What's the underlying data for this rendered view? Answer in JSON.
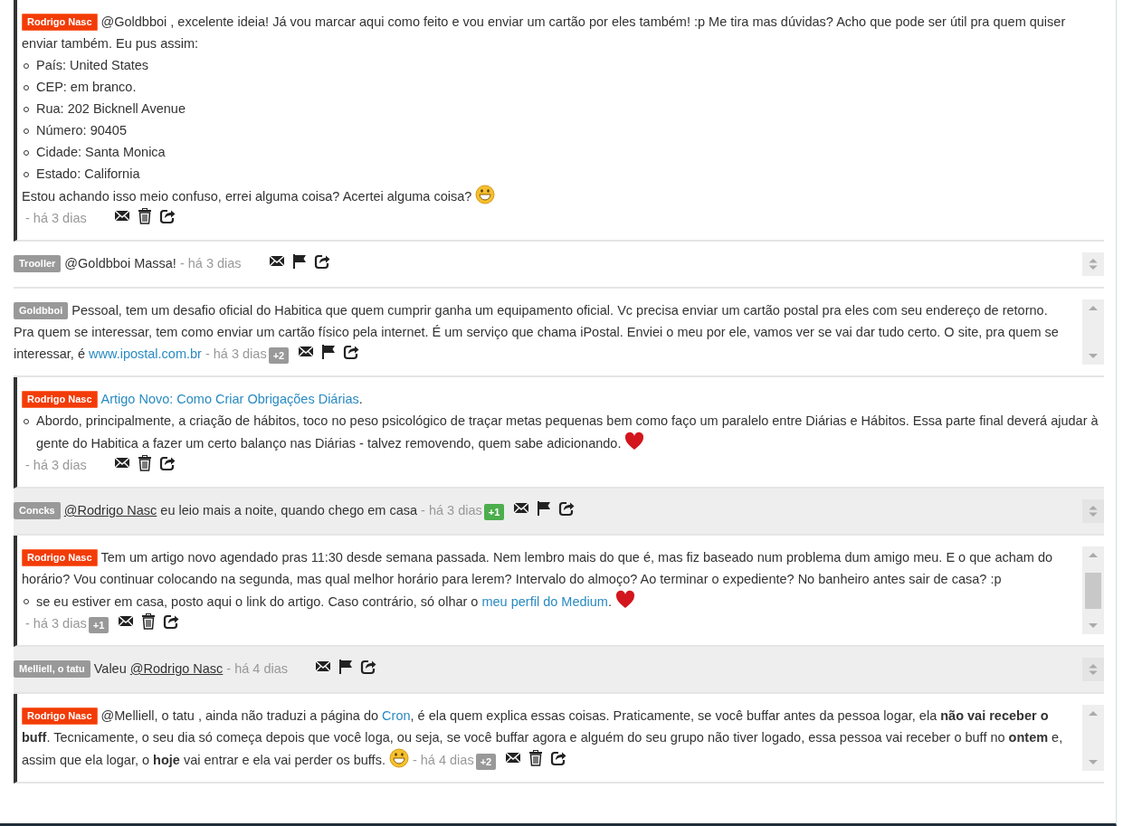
{
  "messages": [
    {
      "author": {
        "name": "Rodrigo Nasc",
        "kind": "leader"
      },
      "own": true,
      "highlighted": false,
      "inline_time": false,
      "paragraphs": [
        {
          "kind": "line",
          "segments": [
            {
              "kind": "text",
              "text": "@Goldbboi , excelente ideia! Já vou marcar aqui como feito e vou enviar um cartão por eles também! :p Me tira mas dúvidas? Acho que pode ser útil pra quem quiser enviar também. Eu pus assim:"
            }
          ]
        },
        {
          "kind": "bullet",
          "segments": [
            {
              "kind": "text",
              "text": "País: United States"
            }
          ]
        },
        {
          "kind": "bullet",
          "segments": [
            {
              "kind": "text",
              "text": "CEP: em branco."
            }
          ]
        },
        {
          "kind": "bullet",
          "segments": [
            {
              "kind": "text",
              "text": "Rua: 202 Bicknell Avenue"
            }
          ]
        },
        {
          "kind": "bullet",
          "segments": [
            {
              "kind": "text",
              "text": "Número: 90405"
            }
          ]
        },
        {
          "kind": "bullet",
          "segments": [
            {
              "kind": "text",
              "text": "Cidade: Santa Monica"
            }
          ]
        },
        {
          "kind": "bullet",
          "segments": [
            {
              "kind": "text",
              "text": "Estado: California"
            }
          ]
        },
        {
          "kind": "line",
          "segments": [
            {
              "kind": "text",
              "text": "Estou achando isso meio confuso, errei alguma coisa? Acertei alguma coisa?"
            },
            {
              "kind": "smiley"
            }
          ]
        }
      ],
      "time": "- há 3 dias",
      "actions": [
        {
          "kind": "mail"
        },
        {
          "kind": "trash"
        },
        {
          "kind": "share"
        }
      ]
    },
    {
      "author": {
        "name": "Trooller",
        "kind": "member"
      },
      "own": false,
      "highlighted": false,
      "side_control": {
        "kind": "compact"
      },
      "inline_time": true,
      "paragraphs": [
        {
          "kind": "line",
          "segments": [
            {
              "kind": "text",
              "text": "@Goldbboi Massa!"
            }
          ]
        }
      ],
      "time": "- há 3 dias",
      "actions": [
        {
          "kind": "mail"
        },
        {
          "kind": "flag"
        },
        {
          "kind": "share"
        }
      ]
    },
    {
      "author": {
        "name": "Goldbboi",
        "kind": "member"
      },
      "own": false,
      "highlighted": false,
      "side_control": {
        "kind": "arrows"
      },
      "inline_time": true,
      "paragraphs": [
        {
          "kind": "line",
          "segments": [
            {
              "kind": "text",
              "text": "Pessoal, tem um desafio oficial do Habitica que quem cumprir ganha um equipamento oficial. Vc precisa enviar um cartão postal pra eles com seu endereço de retorno. Pra quem se interessar, tem como enviar um cartão físico pela internet. É um serviço que chama iPostal. Enviei o meu por ele, vamos ver se vai dar tudo certo. O site, pra quem se interessar, é"
            },
            {
              "kind": "link",
              "text": "www.ipostal.com.br"
            }
          ]
        }
      ],
      "time": "- há 3 dias",
      "votes": {
        "text": "+2",
        "color": "#999999"
      },
      "actions": [
        {
          "kind": "mail"
        },
        {
          "kind": "flag"
        },
        {
          "kind": "share"
        }
      ]
    },
    {
      "author": {
        "name": "Rodrigo Nasc",
        "kind": "leader"
      },
      "own": true,
      "highlighted": false,
      "inline_time": false,
      "paragraphs": [
        {
          "kind": "line",
          "segments": [
            {
              "kind": "link",
              "text": "Artigo Novo: Como Criar Obrigações Diárias"
            },
            {
              "kind": "text",
              "text": "."
            }
          ]
        },
        {
          "kind": "bullet",
          "segments": [
            {
              "kind": "text",
              "text": "Abordo, principalmente, a criação de hábitos, toco no peso psicológico de traçar metas pequenas bem como faço um paralelo entre Diárias e Hábitos. Essa parte final deverá ajudar à gente do Habitica a fazer um certo balanço nas Diárias - talvez removendo, quem sabe adicionando."
            },
            {
              "kind": "heart"
            }
          ]
        }
      ],
      "time": "- há 3 dias",
      "actions": [
        {
          "kind": "mail"
        },
        {
          "kind": "trash"
        },
        {
          "kind": "share"
        }
      ]
    },
    {
      "author": {
        "name": "Concks",
        "kind": "member"
      },
      "own": false,
      "highlighted": true,
      "side_control": {
        "kind": "compact"
      },
      "inline_time": true,
      "paragraphs": [
        {
          "kind": "line",
          "segments": [
            {
              "kind": "mention",
              "text": "@Rodrigo Nasc"
            },
            {
              "kind": "text",
              "text": "eu leio mais a noite, quando chego em casa"
            }
          ]
        }
      ],
      "time": "- há 3 dias",
      "votes": {
        "text": "+1",
        "color": "#4cae4c"
      },
      "actions": [
        {
          "kind": "mail"
        },
        {
          "kind": "flag"
        },
        {
          "kind": "share"
        }
      ]
    },
    {
      "author": {
        "name": "Rodrigo Nasc",
        "kind": "leader"
      },
      "own": true,
      "highlighted": false,
      "side_control": {
        "kind": "scroll"
      },
      "inline_time": false,
      "paragraphs": [
        {
          "kind": "line",
          "segments": [
            {
              "kind": "text",
              "text": "Tem um artigo novo agendado pras 11:30 desde semana passada. Nem lembro mais do que é, mas fiz baseado num problema dum amigo meu. E o que acham do horário? Vou continuar colocando na segunda, mas qual melhor horário para lerem? Intervalo do almoço? Ao terminar o expediente? No banheiro antes sair de casa? :p"
            }
          ]
        },
        {
          "kind": "bullet",
          "segments": [
            {
              "kind": "text",
              "text": "se eu estiver em casa, posto aqui o link do artigo. Caso contrário, só olhar o"
            },
            {
              "kind": "link",
              "text": "meu perfil do Medium"
            },
            {
              "kind": "text",
              "text": "."
            },
            {
              "kind": "heart"
            }
          ]
        }
      ],
      "time": "- há 3 dias",
      "votes": {
        "text": "+1",
        "color": "#999999"
      },
      "actions": [
        {
          "kind": "mail"
        },
        {
          "kind": "trash"
        },
        {
          "kind": "share"
        }
      ]
    },
    {
      "author": {
        "name": "Melliell, o tatu",
        "kind": "member"
      },
      "own": false,
      "highlighted": true,
      "side_control": {
        "kind": "compact"
      },
      "inline_time": true,
      "paragraphs": [
        {
          "kind": "line",
          "segments": [
            {
              "kind": "text",
              "text": "Valeu"
            },
            {
              "kind": "mention",
              "text": "@Rodrigo Nasc"
            }
          ]
        }
      ],
      "time": "- há 4 dias",
      "actions": [
        {
          "kind": "mail"
        },
        {
          "kind": "flag"
        },
        {
          "kind": "share"
        }
      ]
    },
    {
      "author": {
        "name": "Rodrigo Nasc",
        "kind": "leader"
      },
      "own": true,
      "highlighted": false,
      "side_control": {
        "kind": "arrows"
      },
      "inline_time": true,
      "paragraphs": [
        {
          "kind": "line",
          "segments": [
            {
              "kind": "text",
              "text": "@Melliell, o tatu , ainda não traduzi a página do"
            },
            {
              "kind": "link",
              "text": "Cron"
            },
            {
              "kind": "text",
              "text": ", é ela quem explica essas coisas. Praticamente, se você buffar antes da pessoa logar, ela **não vai receber o buff**. Tecnicamente, o seu dia só começa depois que você loga, ou seja, se você buffar agora e alguém do seu grupo não tiver logado, essa pessoa vai receber o buff no **ontem** e, assim que ela logar, o **hoje** vai entrar e ela vai perder os buffs."
            },
            {
              "kind": "smiley"
            }
          ]
        }
      ],
      "time": "- há 4 dias",
      "votes": {
        "text": "+2",
        "color": "#999999"
      },
      "actions": [
        {
          "kind": "mail"
        },
        {
          "kind": "trash"
        },
        {
          "kind": "share"
        }
      ]
    }
  ]
}
